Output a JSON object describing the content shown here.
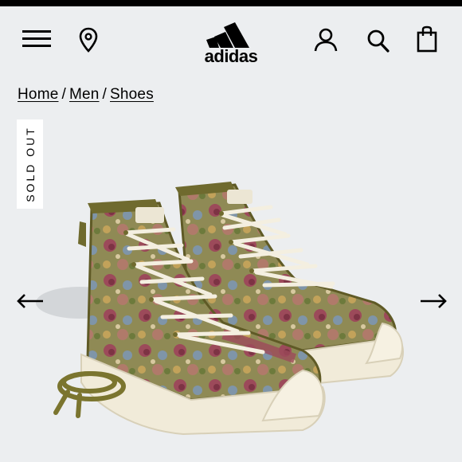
{
  "header": {
    "brand": "adidas",
    "icons": [
      "menu-icon",
      "location-icon",
      "account-icon",
      "search-icon",
      "shopping-bag-icon"
    ]
  },
  "breadcrumb": {
    "items": [
      "Home",
      "Men",
      "Shoes"
    ],
    "separator": "/"
  },
  "product": {
    "status_badge": "SOLD OUT",
    "image_alt": "Floral tapestry high-top sneakers with cream laces, cream rubber sole and a spare olive lace",
    "colors": {
      "upper_olive": "#6f6a2e",
      "sole_cream": "#f1ebd9",
      "lace_cream": "#f4efe0"
    }
  },
  "carousel": {
    "prev_icon": "arrow-left-icon",
    "next_icon": "arrow-right-icon"
  },
  "colors": {
    "background": "#eceef0",
    "topbar": "#000000",
    "badge_bg": "#ffffff"
  }
}
